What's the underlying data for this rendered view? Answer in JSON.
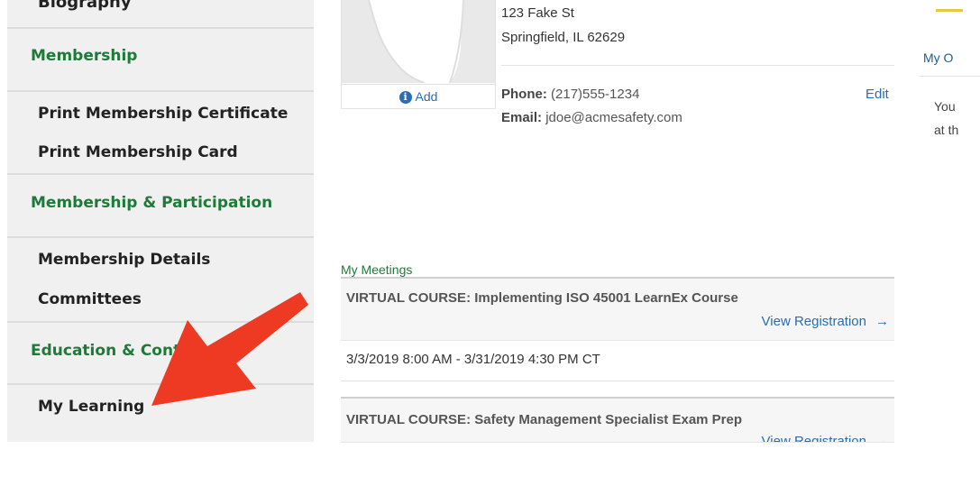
{
  "sidebar": {
    "cut_item": "Biography",
    "sections": [
      {
        "heading": "Membership",
        "items": [
          "Print Membership Certificate",
          "Print Membership Card"
        ]
      },
      {
        "heading": "Membership & Participation",
        "items": [
          "Membership Details",
          "Committees"
        ]
      },
      {
        "heading": "Education & Content",
        "items": [
          "My Learning"
        ]
      }
    ]
  },
  "profile": {
    "photo_add_label": "Add",
    "address_line1": "123 Fake St",
    "address_line2": "Springfield, IL  62629",
    "phone_label": "Phone:",
    "phone_value": "(217)555-1234",
    "email_label": "Email:",
    "email_value": "jdoe@acmesafety.com",
    "edit_label": "Edit"
  },
  "right_panel": {
    "title": "My O",
    "text_line1": "You",
    "text_line2": "at th"
  },
  "meetings": {
    "title": "My Meetings",
    "items": [
      {
        "course": "VIRTUAL COURSE: Implementing ISO 45001 LearnEx Course",
        "link": "View Registration",
        "date": "3/3/2019 8:00 AM - 3/31/2019 4:30 PM CT"
      },
      {
        "course": "VIRTUAL COURSE: Safety Management Specialist Exam Prep",
        "link": "View Registration"
      }
    ],
    "arrow_glyph": "→"
  },
  "annotation": {
    "color": "#ee3a23"
  }
}
